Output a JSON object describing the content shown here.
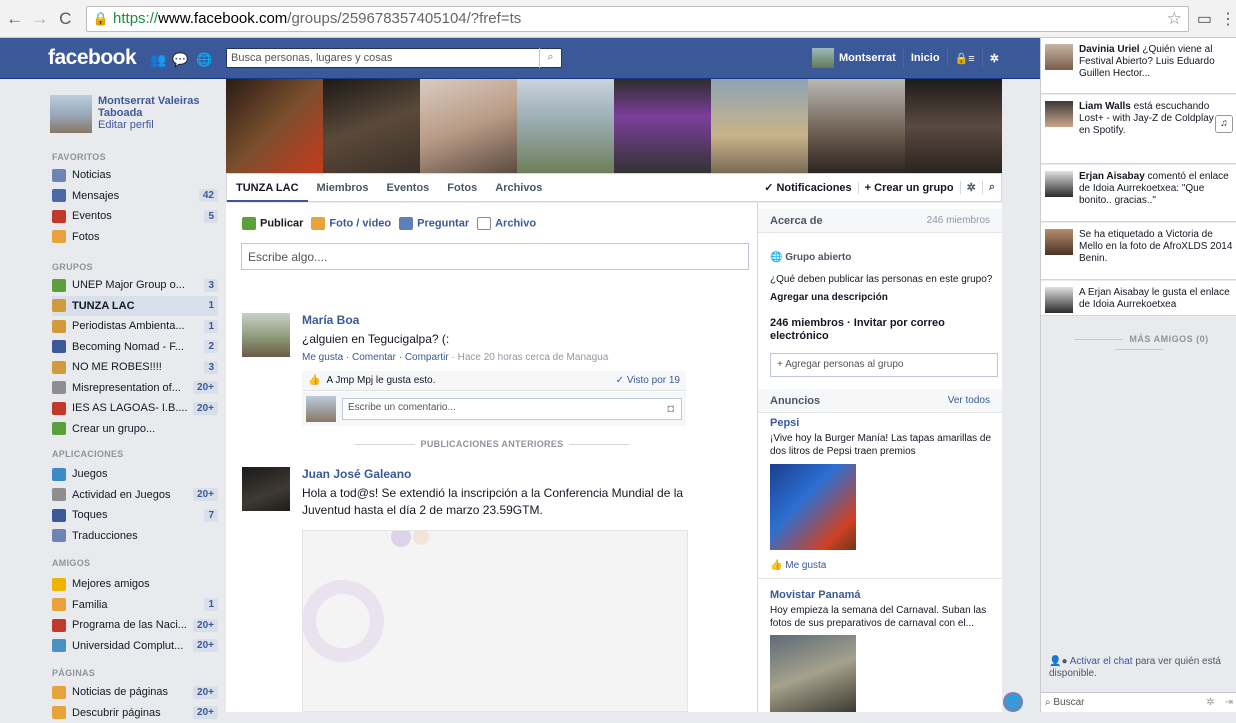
{
  "browser": {
    "url_https": "https://",
    "url_host": "www.facebook.com",
    "url_path": "/groups/259678357405104/?fref=ts"
  },
  "topbar": {
    "logo": "facebook",
    "search_placeholder": "Busca personas, lugares y cosas",
    "user": "Montserrat",
    "home": "Inicio"
  },
  "profile": {
    "name": "Montserrat Valeiras Taboada",
    "edit": "Editar perfil"
  },
  "nav": {
    "favoritos": "FAVORITOS",
    "fav_items": [
      {
        "label": "Noticias",
        "count": ""
      },
      {
        "label": "Mensajes",
        "count": "42"
      },
      {
        "label": "Eventos",
        "count": "5"
      },
      {
        "label": "Fotos",
        "count": ""
      }
    ],
    "grupos": "GRUPOS",
    "group_items": [
      {
        "label": "UNEP Major Group o...",
        "count": "3"
      },
      {
        "label": "TUNZA LAC",
        "count": "1"
      },
      {
        "label": "Periodistas Ambienta...",
        "count": "1"
      },
      {
        "label": "Becoming Nomad - F...",
        "count": "2"
      },
      {
        "label": "NO ME ROBES!!!!",
        "count": "3"
      },
      {
        "label": "Misrepresentation of...",
        "count": "20+"
      },
      {
        "label": "IES AS LAGOAS- I.B....",
        "count": "20+"
      },
      {
        "label": "Crear un grupo...",
        "count": ""
      }
    ],
    "apps": "APLICACIONES",
    "app_items": [
      {
        "label": "Juegos",
        "count": ""
      },
      {
        "label": "Actividad en Juegos",
        "count": "20+"
      },
      {
        "label": "Toques",
        "count": "7"
      },
      {
        "label": "Traducciones",
        "count": ""
      }
    ],
    "amigos": "AMIGOS",
    "amigo_items": [
      {
        "label": "Mejores amigos",
        "count": ""
      },
      {
        "label": "Familia",
        "count": "1"
      },
      {
        "label": "Programa de las Naci...",
        "count": "20+"
      },
      {
        "label": "Universidad Complut...",
        "count": "20+"
      }
    ],
    "paginas": "PÁGINAS",
    "pag_items": [
      {
        "label": "Noticias de páginas",
        "count": "20+"
      },
      {
        "label": "Descubrir páginas",
        "count": "20+"
      }
    ]
  },
  "tabs": {
    "group": "TUNZA LAC",
    "miembros": "Miembros",
    "eventos": "Eventos",
    "fotos": "Fotos",
    "archivos": "Archivos",
    "notif": "✓ Notificaciones",
    "crear": "+ Crear un grupo"
  },
  "composer": {
    "publicar": "Publicar",
    "foto": "Foto / video",
    "preguntar": "Preguntar",
    "archivo": "Archivo",
    "placeholder": "Escribe algo...."
  },
  "post1": {
    "name": "María Boa",
    "msg": "¿alguien en Tegucigalpa? (:",
    "actions": "Me gusta · Comentar · Compartir",
    "time": " · Hace 20 horas cerca de Managua",
    "likes": "A Jmp Mpj le gusta esto.",
    "seen": "✓ Visto por 19",
    "comment_placeholder": "Escribe un comentario..."
  },
  "older": "PUBLICACIONES ANTERIORES",
  "post2": {
    "name": "Juan José Galeano",
    "msg": "Hola a tod@s! Se extendió la inscripción a la Conferencia Mundial de la Juventud hasta el día 2 de marzo 23.59GTM."
  },
  "about": {
    "title": "Acerca de",
    "members": "246 miembros",
    "open": "Grupo abierto",
    "q": "¿Qué deben publicar las personas en este grupo?",
    "add_desc": "Agregar una descripción",
    "count": "246 miembros · Invitar por correo electrónico",
    "add_people": "+ Agregar personas al grupo"
  },
  "ads": {
    "title": "Anuncios",
    "ver": "Ver todos",
    "ad1_name": "Pepsi",
    "ad1_text": "¡Vive hoy la Burger Manía! Las tapas amarillas de dos litros de Pepsi traen premios",
    "ad1_like": "Me gusta",
    "ad2_name": "Movistar Panamá",
    "ad2_text": "Hoy empieza la semana del Carnaval. Suban las fotos de sus preparativos de carnaval con el..."
  },
  "ticker": [
    {
      "who": "Davinia Uriel",
      "text": " ¿Quién viene al Festival Abierto? Luis Eduardo Guillen Hector..."
    },
    {
      "who": "Liam Walls",
      "text": " está escuchando Lost+ - with Jay-Z de Coldplay en Spotify."
    },
    {
      "who": "Erjan Aisabay",
      "text": " comentó el enlace de Idoia Aurrekoetxea: \"Que bonito.. gracias..\""
    },
    {
      "who": "",
      "text": "Se ha etiquetado a Victoria de Mello en la foto de AfroXLDS 2014 Benin."
    },
    {
      "who": "",
      "text": "A Erjan Aisabay le gusta el enlace de Idoia Aurrekoetxea"
    }
  ],
  "chat": {
    "mas": "MÁS AMIGOS (0)",
    "activar": "Activar el chat",
    "activar_rest": " para ver quién está disponible.",
    "buscar": "Buscar"
  }
}
